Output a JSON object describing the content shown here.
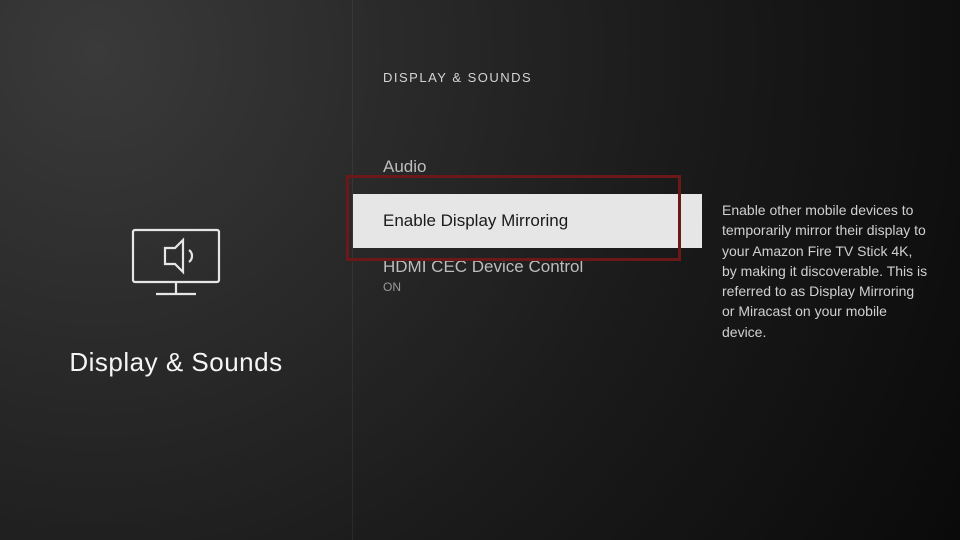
{
  "category": {
    "title": "Display & Sounds",
    "icon": "tv-speaker-icon"
  },
  "breadcrumb": "DISPLAY & SOUNDS",
  "menu": {
    "items": [
      {
        "label": "Audio",
        "sub": "",
        "selected": false
      },
      {
        "label": "Enable Display Mirroring",
        "sub": "",
        "selected": true
      },
      {
        "label": "HDMI CEC Device Control",
        "sub": "ON",
        "selected": false
      }
    ]
  },
  "description": "Enable other mobile devices to temporarily mirror their display to your Amazon Fire TV Stick 4K, by making it discoverable. This is referred to as Display Mirroring or Miracast on your mobile device."
}
